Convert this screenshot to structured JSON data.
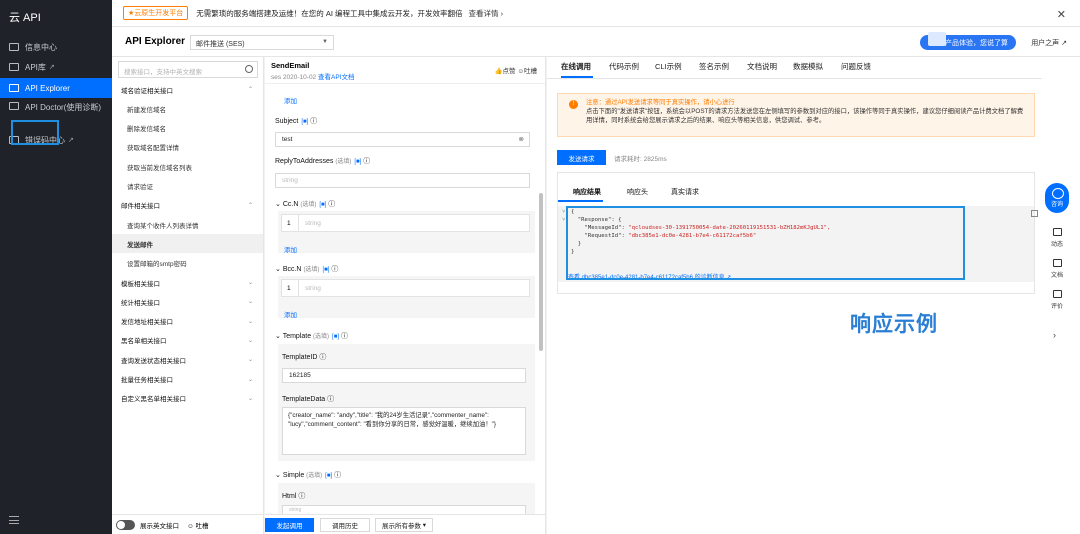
{
  "app": {
    "title": "云 API"
  },
  "nav": {
    "items": [
      {
        "label": "信息中心",
        "icon": "grid-icon",
        "external": false
      },
      {
        "label": "API库",
        "icon": "book-icon",
        "external": true
      },
      {
        "label": "API Explorer",
        "icon": "terminal-icon",
        "external": false,
        "active": true
      },
      {
        "label": "API Doctor(使用诊断)",
        "icon": "stethoscope-icon",
        "external": false
      },
      {
        "label": "错误码中心",
        "icon": "error-icon",
        "external": true
      }
    ]
  },
  "banner": {
    "tag": "★云原生开发平台",
    "message": "无需繁琐的服务端搭建及运维！在您的 AI 编程工具中集成云开发，开发效率翻倍",
    "more": "查看详情 ›"
  },
  "header": {
    "title": "API Explorer",
    "service_select": "邮件推送 (SES)",
    "promo": "产品体验，您说了算",
    "user_link": "用户之声"
  },
  "apilist": {
    "search_placeholder": "搜索接口，支持中英文搜索",
    "rows": [
      {
        "label": "域名验证相关接口",
        "type": "grp",
        "chev": "⌃"
      },
      {
        "label": "新建发信域名",
        "type": "sub"
      },
      {
        "label": "删除发信域名",
        "type": "sub"
      },
      {
        "label": "获取域名配置详情",
        "type": "sub"
      },
      {
        "label": "获取当前发信域名列表",
        "type": "sub"
      },
      {
        "label": "请求验证",
        "type": "sub"
      },
      {
        "label": "邮件相关接口",
        "type": "grp",
        "chev": "⌃"
      },
      {
        "label": "查询某个收件人列表详情",
        "type": "sub"
      },
      {
        "label": "发送邮件",
        "type": "sub",
        "active": true
      },
      {
        "label": "设置邮箱的smtp密码",
        "type": "sub"
      },
      {
        "label": "模板相关接口",
        "type": "grp",
        "chev": "⌄"
      },
      {
        "label": "统计相关接口",
        "type": "grp",
        "chev": "⌄"
      },
      {
        "label": "发信地址相关接口",
        "type": "grp",
        "chev": "⌄"
      },
      {
        "label": "黑名单相关接口",
        "type": "grp",
        "chev": "⌄"
      },
      {
        "label": "查询发送状态相关接口",
        "type": "grp",
        "chev": "⌄"
      },
      {
        "label": "批量任务相关接口",
        "type": "grp",
        "chev": "⌄"
      },
      {
        "label": "自定义黑名单相关接口",
        "type": "grp",
        "chev": "⌄"
      }
    ],
    "footer_toggle_label": "展示英文接口",
    "footer_feedback": "吐槽"
  },
  "params": {
    "api_name": "SendEmail",
    "api_version": "ses 2020-10-02",
    "doc_link": "查看API文档",
    "like": "点赞",
    "feedback": "吐槽",
    "add_label": "添加",
    "fields": {
      "subject": {
        "label": "Subject",
        "tags": "[■]",
        "value": "test"
      },
      "reply_to": {
        "label": "ReplyToAddresses",
        "optional": "(选填)",
        "tags": "[■]",
        "placeholder": "string"
      },
      "cc": {
        "label": "Cc.N",
        "optional": "(选填)",
        "tags": "[■]",
        "index": "1",
        "placeholder": "string"
      },
      "bcc": {
        "label": "Bcc.N",
        "optional": "(选填)",
        "tags": "[■]",
        "index": "1",
        "placeholder": "string"
      },
      "template": {
        "label": "Template",
        "optional": "(选填)",
        "tags": "[■]"
      },
      "template_id": {
        "label": "TemplateID",
        "value": "162185"
      },
      "template_data": {
        "label": "TemplateData",
        "value": "{\"creator_name\": \"andy\",\"title\": \"我的24岁生活记录\",\"commenter_name\": \"lucy\",\"comment_content\": \"看到你分享的日常，感觉好温暖，继续加油！\"}"
      },
      "simple": {
        "label": "Simple",
        "optional": "(选填)",
        "tags": "[■]"
      },
      "html": {
        "label": "Html",
        "placeholder": "string"
      }
    },
    "buttons": {
      "send": "发起调用",
      "history": "调用历史",
      "show_all": "展示所有参数"
    }
  },
  "right": {
    "tabs": [
      "在线调用",
      "代码示例",
      "CLI示例",
      "签名示例",
      "文档说明",
      "数据模拟",
      "问题反馈"
    ],
    "warning_line1": "注意：通过API发送请求等同于真实操作，请小心进行",
    "warning_line2": "点击下面的\"发送请求\"按钮，系统会以POST的请求方法发送您在左侧填写的参数到对应的接口，该操作等同于真实操作，建议您仔细阅读产品计费文档了解费用详情，同时系统会给您展示请求之后的结果、响应头等相关信息，供您调试、参考。",
    "send_button": "发送请求",
    "request_time": "请求耗时: 2825ms",
    "sub_tabs": [
      "响应结果",
      "响应头",
      "真实请求"
    ],
    "response_lines": [
      {
        "t": "{",
        "fold": "˅"
      },
      {
        "t": "  \"Response\": {",
        "fold": "˅"
      },
      {
        "t": "    \"MessageId\": ",
        "s": "\"qcloudses-30-1391750054-date-20260119151531-bZH182mKJgUL1\","
      },
      {
        "t": "    \"RequestId\": ",
        "s": "\"dbc385e1-dc0e-4281-b7e4-c61172caf5b6\""
      },
      {
        "t": "  }"
      },
      {
        "t": "}"
      }
    ],
    "diagnosis": "查看 dbc385e1-dc0e-4281-b7e4-c61172caf5b6 的诊断信息 ↗",
    "example_label": "响应示例"
  },
  "floatbar": {
    "consult": "咨询",
    "items": [
      {
        "label": "动态",
        "icon": "cloud-icon"
      },
      {
        "label": "文档",
        "icon": "doc-icon"
      },
      {
        "label": "评价",
        "icon": "feedback-icon"
      }
    ]
  }
}
